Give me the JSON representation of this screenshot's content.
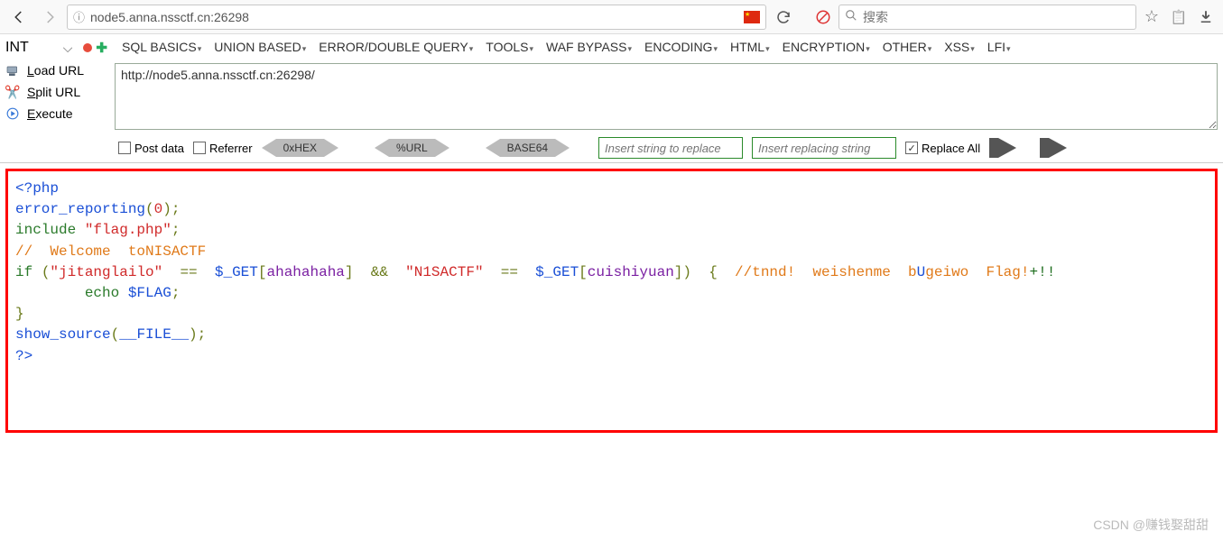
{
  "browser": {
    "url": "node5.anna.nssctf.cn:26298",
    "search_placeholder": "搜索"
  },
  "hackbar": {
    "int_label": "INT",
    "actions": {
      "load": "Load URL",
      "split": "Split URL",
      "execute": "Execute"
    },
    "menu": [
      "SQL BASICS",
      "UNION BASED",
      "ERROR/DOUBLE QUERY",
      "TOOLS",
      "WAF BYPASS",
      "ENCODING",
      "HTML",
      "ENCRYPTION",
      "OTHER",
      "XSS",
      "LFI"
    ],
    "url_value": "http://node5.anna.nssctf.cn:26298/",
    "options": {
      "post_data": "Post data",
      "referrer": "Referrer",
      "hex": "0xHEX",
      "url_enc": "%URL",
      "base64": "BASE64",
      "replace_find_ph": "Insert string to replace",
      "replace_with_ph": "Insert replacing string",
      "replace_all": "Replace All"
    }
  },
  "code": {
    "l1": "<?php",
    "l2a": "error_reporting",
    "l2b": "(",
    "l2c": "0",
    "l2d": ");",
    "l3a": "include ",
    "l3b": "\"flag.php\"",
    "l3c": ";",
    "l4": "//  Welcome  toNISACTF",
    "l5a": "if ",
    "l5b": "(",
    "l5c": "\"jitanglailo\"",
    "l5d": "  ==  ",
    "l5e": "$_GET",
    "l5f": "[",
    "l5g": "ahahahaha",
    "l5h": "]  ",
    "l5i": "&&  ",
    "l5j": "\"N1SACTF\"",
    "l5k": "  ==  ",
    "l5l": "$_GET",
    "l5m": "[",
    "l5n": "cuishiyuan",
    "l5o": "])  ",
    "l5p": "{  ",
    "l5q": "//tnnd!  weishenme  b",
    "l5r": "U",
    "l5s": "geiwo  Flag!",
    "l5t": "+!!",
    "l6a": "        echo ",
    "l6b": "$FLAG",
    "l6c": ";",
    "l7": "}",
    "l8a": "show_source",
    "l8b": "(",
    "l8c": "__FILE__",
    "l8d": ");",
    "l9": "?>"
  },
  "watermark": "CSDN @赚钱娶甜甜"
}
